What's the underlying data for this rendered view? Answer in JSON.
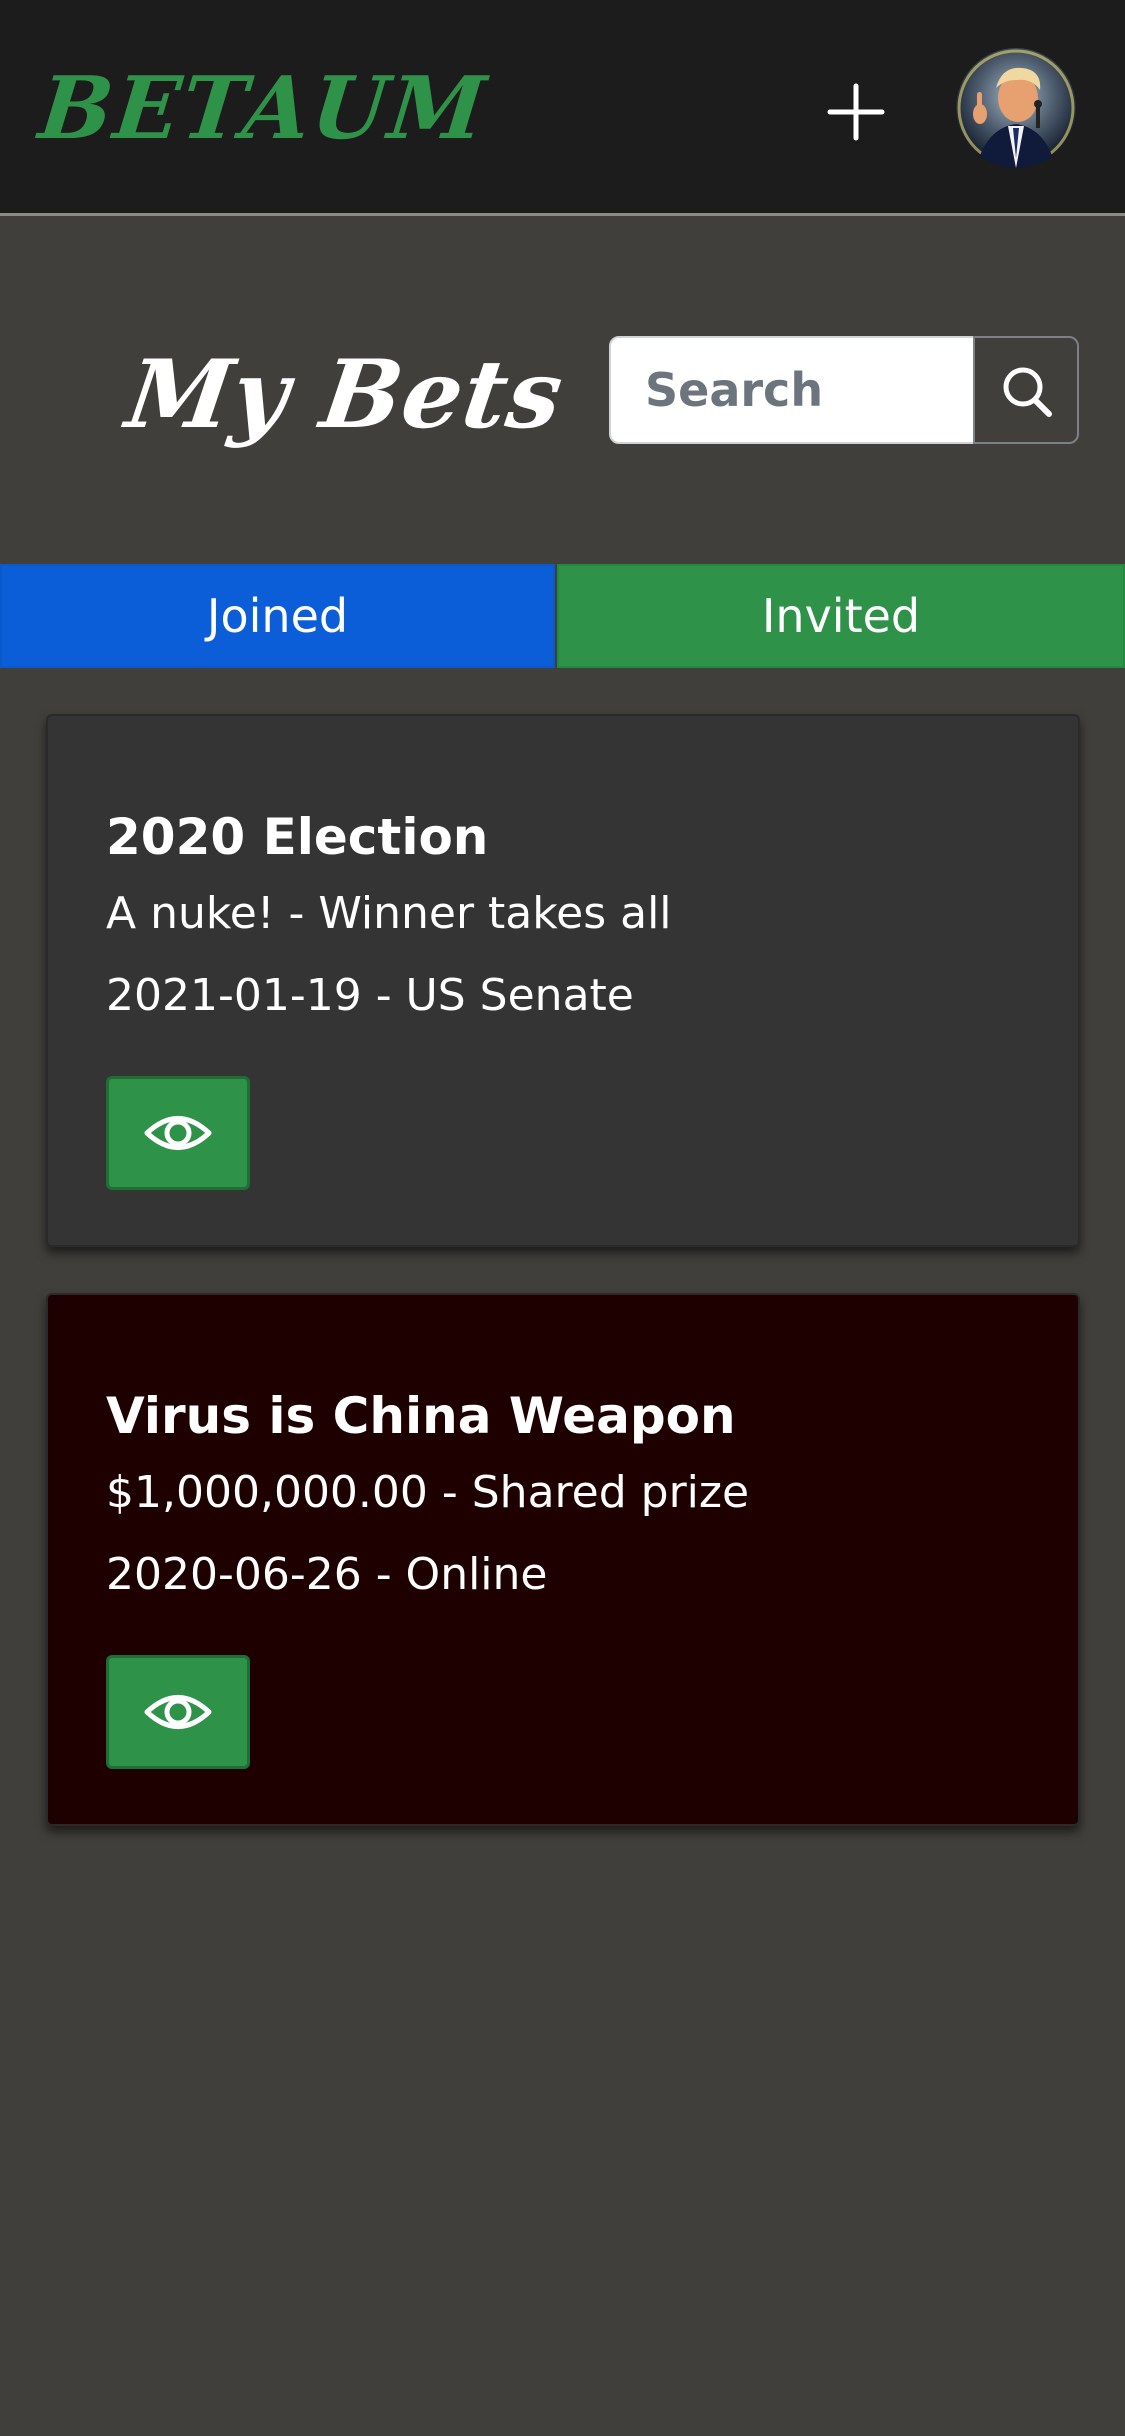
{
  "header": {
    "brand": "BETAUM",
    "icons": {
      "add": "plus-icon",
      "avatar": "user-avatar"
    },
    "brand_color": "#2e9249"
  },
  "page": {
    "title": "My Bets",
    "search": {
      "placeholder": "Search",
      "value": ""
    },
    "search_icon": "search-icon"
  },
  "tabs": [
    {
      "label": "Joined",
      "color": "#0b5ed7",
      "active": true
    },
    {
      "label": "Invited",
      "color": "#2e9249",
      "active": false
    }
  ],
  "bets": [
    {
      "title": "2020 Election",
      "subtitle": "A nuke! - Winner takes all",
      "meta": "2021-01-19 - US Senate",
      "background": "#343435",
      "action_icon": "eye-icon"
    },
    {
      "title": "Virus is China Weapon",
      "subtitle": "$1,000,000.00 - Shared prize",
      "meta": "2020-06-26 - Online",
      "background": "#1f0000",
      "action_icon": "eye-icon"
    }
  ]
}
